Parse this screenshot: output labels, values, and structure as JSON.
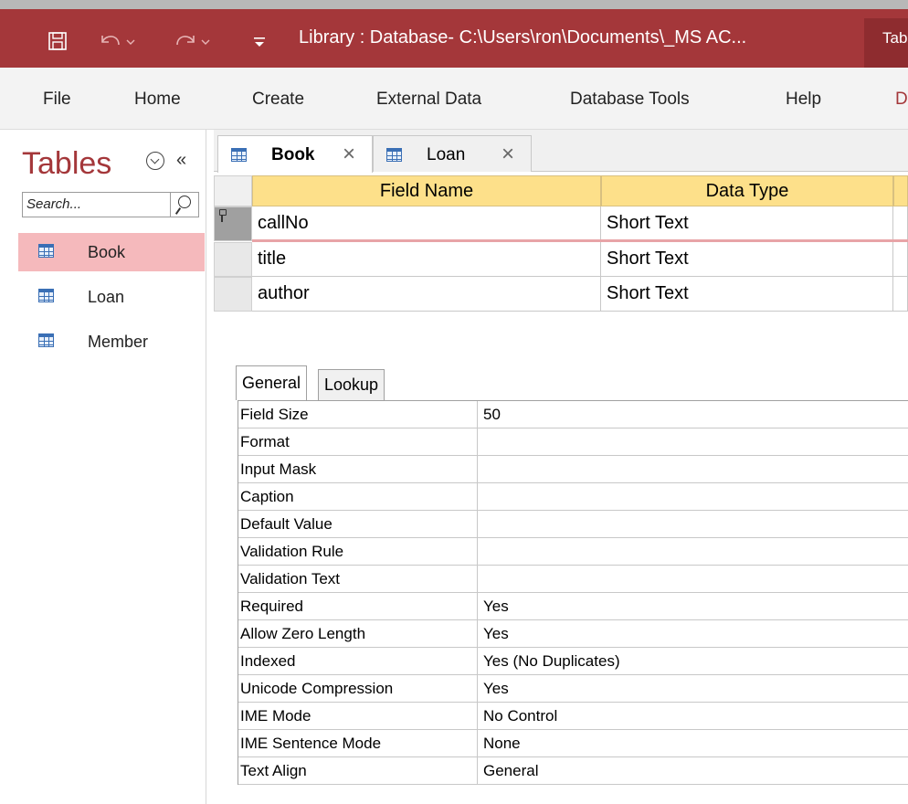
{
  "titlebar": {
    "title": "Library : Database- C:\\Users\\ron\\Documents\\_MS AC...",
    "right_tab": "Tab",
    "icons": [
      "save-icon",
      "undo-icon",
      "redo-icon",
      "customize-qat-icon"
    ]
  },
  "ribbon": {
    "tabs": [
      "File",
      "Home",
      "Create",
      "External Data",
      "Database Tools",
      "Help",
      "D"
    ]
  },
  "nav": {
    "title": "Tables",
    "collapse_glyph": "«",
    "search_placeholder": "Search...",
    "items": [
      {
        "label": "Book",
        "selected": true
      },
      {
        "label": "Loan",
        "selected": false
      },
      {
        "label": "Member",
        "selected": false
      }
    ]
  },
  "doc_tabs": [
    {
      "label": "Book",
      "active": true
    },
    {
      "label": "Loan",
      "active": false
    }
  ],
  "design_grid": {
    "headers": [
      "Field Name",
      "Data Type"
    ],
    "rows": [
      {
        "field": "callNo",
        "type": "Short Text",
        "primary_key": true
      },
      {
        "field": "title",
        "type": "Short Text",
        "primary_key": false
      },
      {
        "field": "author",
        "type": "Short Text",
        "primary_key": false
      }
    ]
  },
  "field_properties": {
    "tabs": [
      "General",
      "Lookup"
    ],
    "rows": [
      {
        "name": "Field Size",
        "value": "50"
      },
      {
        "name": "Format",
        "value": ""
      },
      {
        "name": "Input Mask",
        "value": ""
      },
      {
        "name": "Caption",
        "value": ""
      },
      {
        "name": "Default Value",
        "value": ""
      },
      {
        "name": "Validation Rule",
        "value": ""
      },
      {
        "name": "Validation Text",
        "value": ""
      },
      {
        "name": "Required",
        "value": "Yes"
      },
      {
        "name": "Allow Zero Length",
        "value": "Yes"
      },
      {
        "name": "Indexed",
        "value": "Yes (No Duplicates)"
      },
      {
        "name": "Unicode Compression",
        "value": "Yes"
      },
      {
        "name": "IME Mode",
        "value": "No Control"
      },
      {
        "name": "IME Sentence Mode",
        "value": "None"
      },
      {
        "name": "Text Align",
        "value": "General"
      }
    ]
  },
  "colors": {
    "accent": "#a4373a",
    "selected_nav": "#f5b9bc",
    "grid_header": "#fde08a"
  }
}
